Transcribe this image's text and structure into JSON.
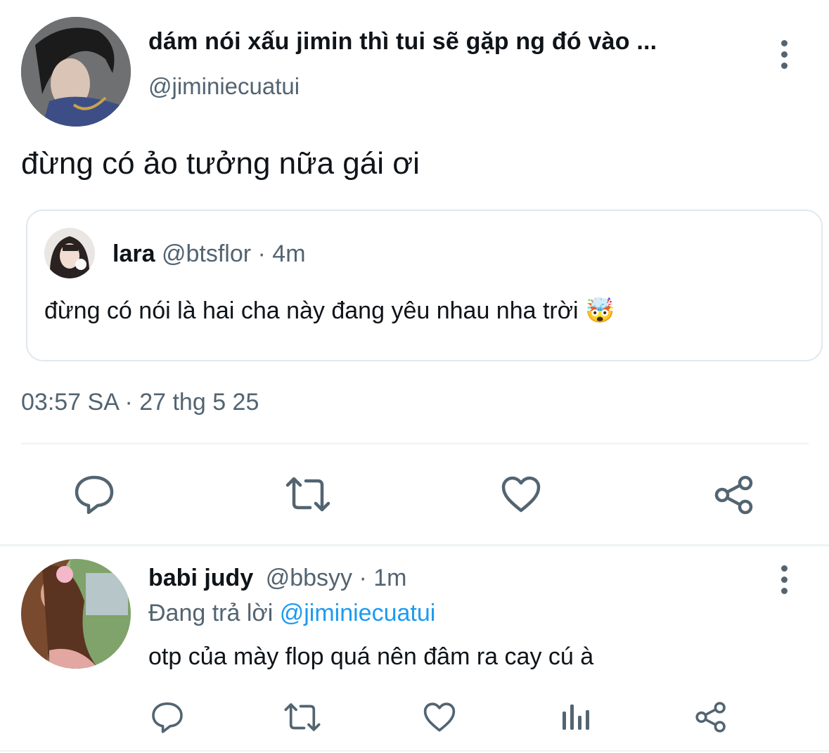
{
  "main_tweet": {
    "display_name": "dám nói xấu jimin thì tui sẽ gặp ng đó vào ...",
    "handle": "@jiminiecuatui",
    "text": "đừng có ảo tưởng nữa gái ơi",
    "timestamp": "03:57 SA · 27 thg 5 25",
    "more_icon": "more-vertical-icon"
  },
  "quoted_tweet": {
    "display_name": "lara",
    "handle": "@btsflor",
    "separator": "·",
    "time": "4m",
    "text": "đừng có nói là hai cha này đang yêu nhau nha trời",
    "emoji": "🤯"
  },
  "main_actions": [
    "reply-icon",
    "retweet-icon",
    "like-icon",
    "share-icon"
  ],
  "reply_tweet": {
    "display_name": "babi judy",
    "handle": "@bbsyy",
    "separator": "·",
    "time": "1m",
    "replying_prefix": "Đang trả lời",
    "replying_to": "@jiminiecuatui",
    "text": "otp của mày flop quá nên đâm ra cay cú à",
    "actions": [
      "reply-icon",
      "retweet-icon",
      "like-icon",
      "analytics-icon",
      "share-icon"
    ]
  },
  "colors": {
    "text": "#0f1419",
    "muted": "#536471",
    "link": "#1d9bf0",
    "divider": "#eff3f4",
    "border": "#cfd9de"
  }
}
